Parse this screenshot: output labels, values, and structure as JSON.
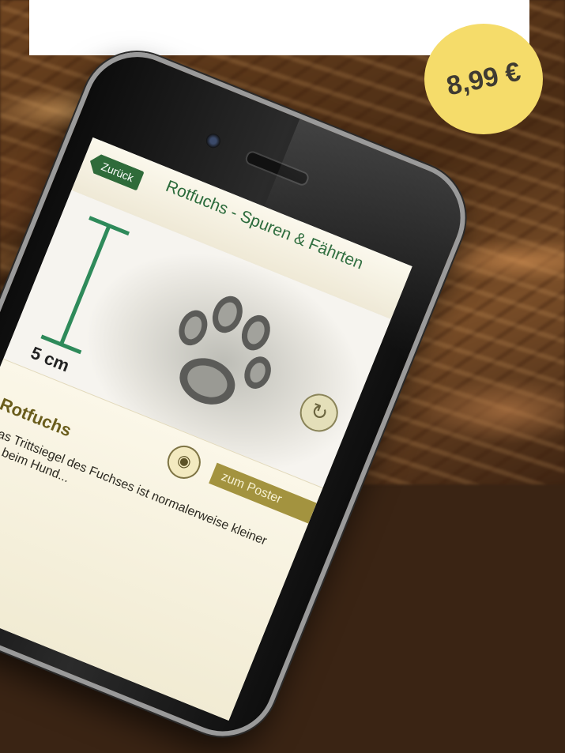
{
  "price": {
    "label": "8,99 €",
    "color": "#f5dc6a"
  },
  "app": {
    "back_label": "Zurück",
    "title": "Rotfuchs - Spuren & Fährten",
    "scale_label": "5 cm",
    "species_name": "Rotfuchs",
    "poster_label": "zum Poster",
    "description": "Das Trittsiegel des Fuchses ist normalerweise kleiner als beim Hund...",
    "accent_color": "#2f6b3a",
    "icons": [
      "back-arrow-icon",
      "rotate-icon",
      "eye-icon"
    ]
  }
}
